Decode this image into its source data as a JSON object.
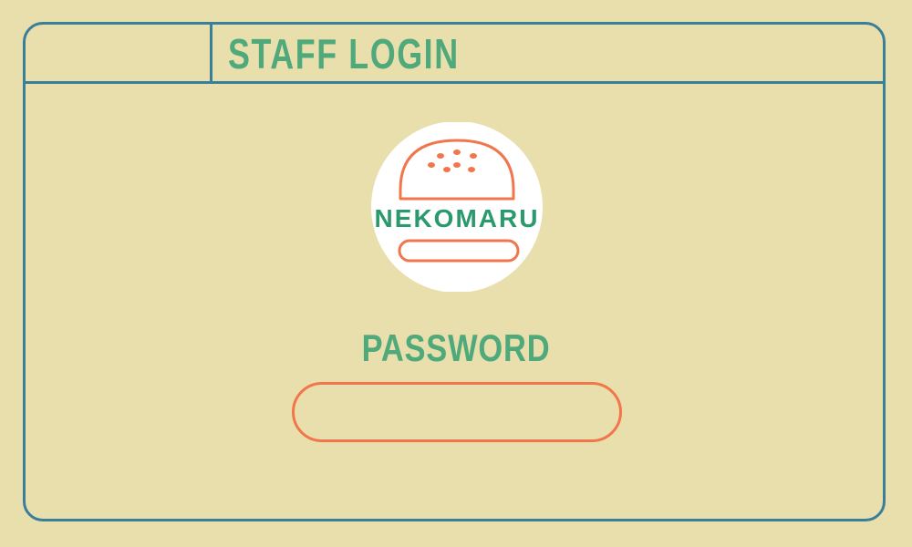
{
  "header": {
    "title": "STAFF LOGIN"
  },
  "logo": {
    "brand": "NEKOMARU",
    "icon": "burger-icon"
  },
  "login": {
    "password_label": "PASSWORD",
    "password_value": "",
    "password_placeholder": ""
  },
  "colors": {
    "background": "#e9dfac",
    "border": "#3a7f99",
    "heading": "#4fa97a",
    "brand_text": "#2a9a6e",
    "accent": "#f2764b",
    "logo_bg": "#ffffff"
  }
}
